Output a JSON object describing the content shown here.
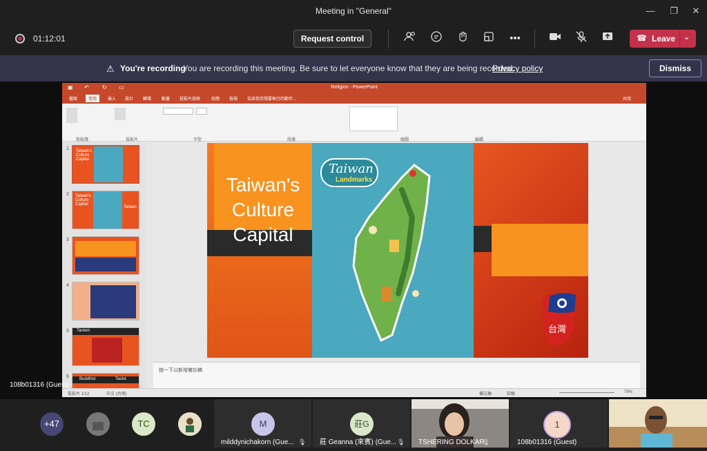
{
  "window": {
    "title": "Meeting in \"General\""
  },
  "toolbar": {
    "timer": "01:12:01",
    "request_control": "Request control",
    "leave": "Leave"
  },
  "banner": {
    "title": "You're recording",
    "text": "You are recording this meeting. Be sure to let everyone know that they are being recorded.",
    "link": "Privacy policy",
    "dismiss": "Dismiss"
  },
  "ppt": {
    "title": "Religion - PowerPoint",
    "share": "共用",
    "tabs": [
      "檔案",
      "常用",
      "插入",
      "設計",
      "轉場",
      "動畫",
      "投影片放映",
      "校閱",
      "檢視"
    ],
    "search_hint": "告訴我您想要執行的動作...",
    "groups": [
      "剪貼簿",
      "投影片",
      "字型",
      "段落",
      "繪圖",
      "編輯"
    ],
    "slide_nums": [
      "1",
      "2",
      "3",
      "4",
      "5",
      "6"
    ],
    "thumb_texts": [
      "Taiwan's Culture Capital",
      "Taiwan's Culture Capital",
      "Taiwan",
      "Taoism",
      "Buddhist",
      "Taoist"
    ],
    "notes_hint": "按一下以新增備忘稿",
    "status_left": "投影片 1/12",
    "status_lang": "中文 (台灣)",
    "status_notes": "備忘稿",
    "status_comments": "註解",
    "zoom": "79%"
  },
  "slide": {
    "title_l1": "Taiwan's",
    "title_l2": "Culture",
    "title_l3": "Capital",
    "map_title": "Taiwan",
    "map_sub": "Landmarks",
    "flag_text": "台灣"
  },
  "presenter": "108b01316 (Guest)",
  "participants": {
    "overflow": "+47",
    "initials_tc": "TC",
    "tiles": [
      {
        "initial": "M",
        "name": "milddynichakorn (Gue..."
      },
      {
        "initial": "莊G",
        "name": "莊 Geanna (來賓) (Gue..."
      },
      {
        "name": "TSHERING DOLKAR"
      },
      {
        "initial": "1",
        "name": "108b01316 (Guest)"
      }
    ]
  },
  "colors": {
    "leave": "#c4314b",
    "banner": "#33344a",
    "ppt_accent": "#c5482a"
  }
}
